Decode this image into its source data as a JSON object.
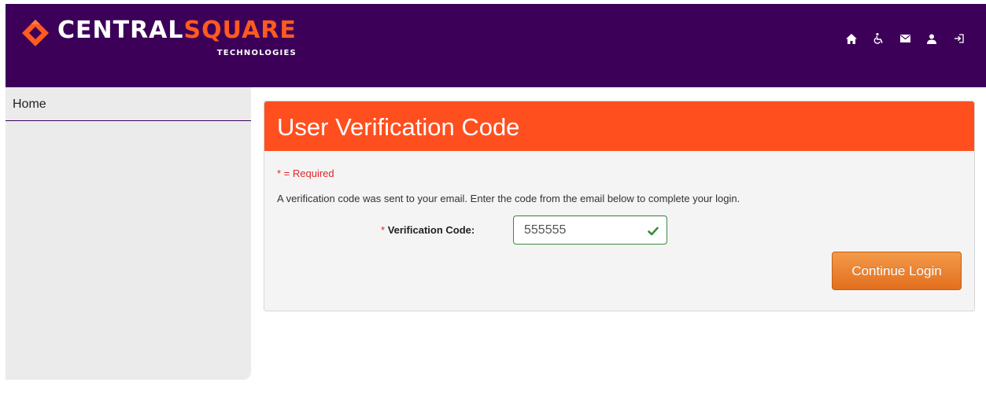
{
  "header": {
    "brand_part1": "CENTRAL",
    "brand_part2": "SQUARE",
    "tagline": "TECHNOLOGIES",
    "icons": [
      "home-icon",
      "accessibility-icon",
      "mail-icon",
      "user-icon",
      "logout-icon"
    ],
    "background_color": "#3c0059",
    "accent_color": "#ff5a1f"
  },
  "sidebar": {
    "items": [
      {
        "label": "Home"
      }
    ]
  },
  "panel": {
    "title": "User Verification Code",
    "required_note": "* = Required",
    "instructions": "A verification code was sent to your email. Enter the code from the email below to complete your login.",
    "field": {
      "required_marker": "*",
      "label": "Verification Code:",
      "value": "555555",
      "valid": true
    },
    "continue_label": "Continue Login",
    "header_color": "#ff4f1f"
  }
}
